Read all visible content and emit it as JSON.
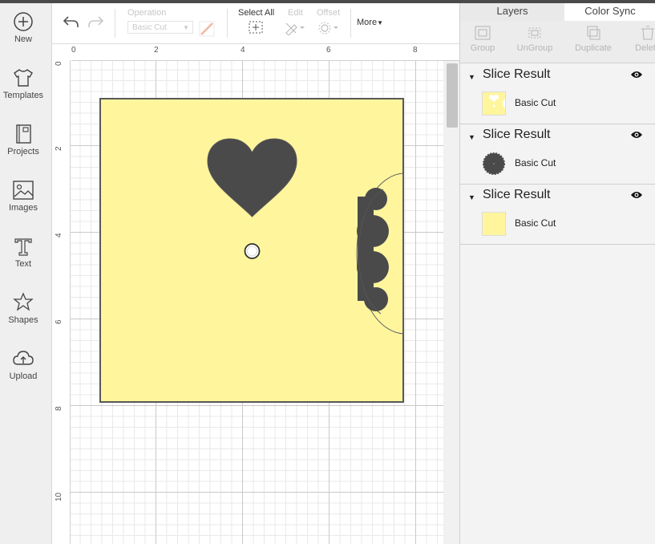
{
  "nav": {
    "items": [
      {
        "label": "New",
        "icon": "plus-circle-icon"
      },
      {
        "label": "Templates",
        "icon": "tshirt-icon"
      },
      {
        "label": "Projects",
        "icon": "projects-icon"
      },
      {
        "label": "Images",
        "icon": "image-icon"
      },
      {
        "label": "Text",
        "icon": "text-icon"
      },
      {
        "label": "Shapes",
        "icon": "shapes-icon"
      },
      {
        "label": "Upload",
        "icon": "upload-cloud-icon"
      }
    ]
  },
  "toolbar": {
    "operation_label": "Operation",
    "operation_value": "Basic Cut",
    "select_all_label": "Select All",
    "edit_label": "Edit",
    "offset_label": "Offset",
    "more_label": "More"
  },
  "rulers": {
    "top": [
      "0",
      "2",
      "4",
      "6",
      "8"
    ],
    "left": [
      "0",
      "2",
      "4",
      "6",
      "8",
      "10"
    ]
  },
  "panel": {
    "tabs": [
      "Layers",
      "Color Sync"
    ],
    "tools": [
      "Group",
      "UnGroup",
      "Duplicate",
      "Delete"
    ],
    "groups": [
      {
        "title": "Slice Result",
        "layer_name": "Basic Cut"
      },
      {
        "title": "Slice Result",
        "layer_name": "Basic Cut"
      },
      {
        "title": "Slice Result",
        "layer_name": "Basic Cut"
      }
    ]
  },
  "colors": {
    "material": "#fff59d",
    "cut_shape": "#4a4a4a",
    "outline": "#555555"
  }
}
